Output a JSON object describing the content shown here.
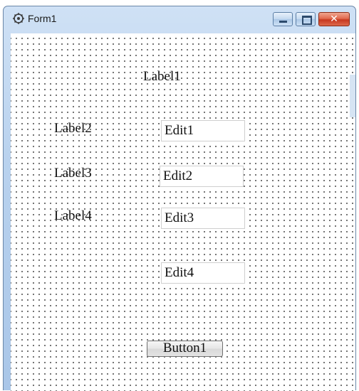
{
  "window": {
    "title": "Form1",
    "icon": "form-designer-icon",
    "caption_buttons": {
      "minimize": "minimize-icon",
      "maximize": "maximize-icon",
      "close": "close-icon",
      "close_glyph": "✕"
    }
  },
  "form": {
    "label1": "Label1",
    "label2": "Label2",
    "label3": "Label3",
    "label4": "Label4",
    "edit1": "Edit1",
    "edit2": "Edit2",
    "edit3": "Edit3",
    "edit4": "Edit4",
    "button1": "Button1"
  },
  "colors": {
    "frame": "#b9d2ee",
    "close_button": "#c7381f",
    "grid_dot": "#5a5a5a"
  }
}
